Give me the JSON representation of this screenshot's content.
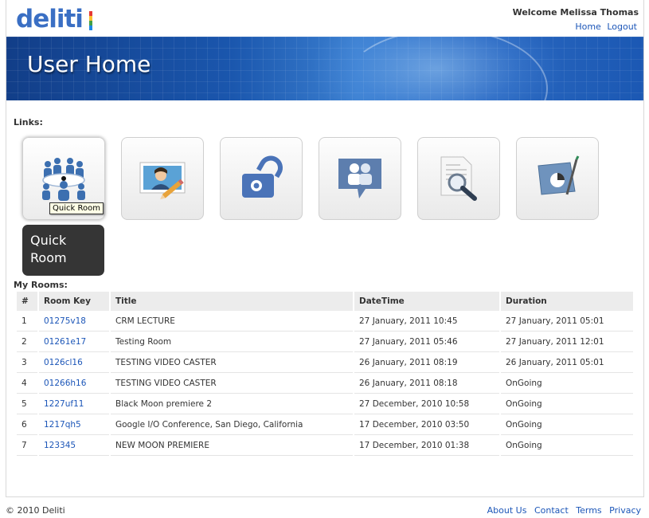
{
  "brand": {
    "logo_text": "deliti",
    "logo_bar_colors": [
      "#e53935",
      "#fbc02d",
      "#43a047",
      "#1e88e5"
    ]
  },
  "header": {
    "welcome": "Welcome Melissa Thomas",
    "links": [
      "Home",
      "Logout"
    ]
  },
  "banner": {
    "title": "User Home"
  },
  "links_section": {
    "label": "Links:",
    "tiles": [
      {
        "icon": "meeting-room-icon",
        "active": true
      },
      {
        "icon": "profile-edit-icon"
      },
      {
        "icon": "lock-icon"
      },
      {
        "icon": "chat-users-icon"
      },
      {
        "icon": "document-search-icon"
      },
      {
        "icon": "chart-report-icon"
      }
    ],
    "tooltip": "Quick Room",
    "hover_popup": "Quick Room"
  },
  "rooms": {
    "label": "My Rooms:",
    "columns": [
      "#",
      "Room Key",
      "Title",
      "DateTime",
      "Duration"
    ],
    "rows": [
      [
        "1",
        "01275v18",
        "CRM LECTURE",
        "27 January, 2011 10:45",
        "27 January, 2011 05:01"
      ],
      [
        "2",
        "01261e17",
        "Testing Room",
        "27 January, 2011 05:46",
        "27 January, 2011 12:01"
      ],
      [
        "3",
        "0126cl16",
        "TESTING VIDEO CASTER",
        "26 January, 2011 08:19",
        "26 January, 2011 05:01"
      ],
      [
        "4",
        "01266h16",
        "TESTING VIDEO CASTER",
        "26 January, 2011 08:18",
        "OnGoing"
      ],
      [
        "5",
        "1227uf11",
        "Black Moon premiere 2",
        "27 December, 2010 10:58",
        "OnGoing"
      ],
      [
        "6",
        "1217qh5",
        "Google I/O Conference, San Diego, California",
        "17 December, 2010 03:50",
        "OnGoing"
      ],
      [
        "7",
        "123345",
        "NEW MOON PREMIERE",
        "17 December, 2010 01:38",
        "OnGoing"
      ]
    ]
  },
  "footer": {
    "copyright": "© 2010 Deliti",
    "links": [
      "About Us",
      "Contact",
      "Terms",
      "Privacy"
    ]
  },
  "colors": {
    "link": "#1c56b8",
    "banner": "#1a56ad"
  }
}
